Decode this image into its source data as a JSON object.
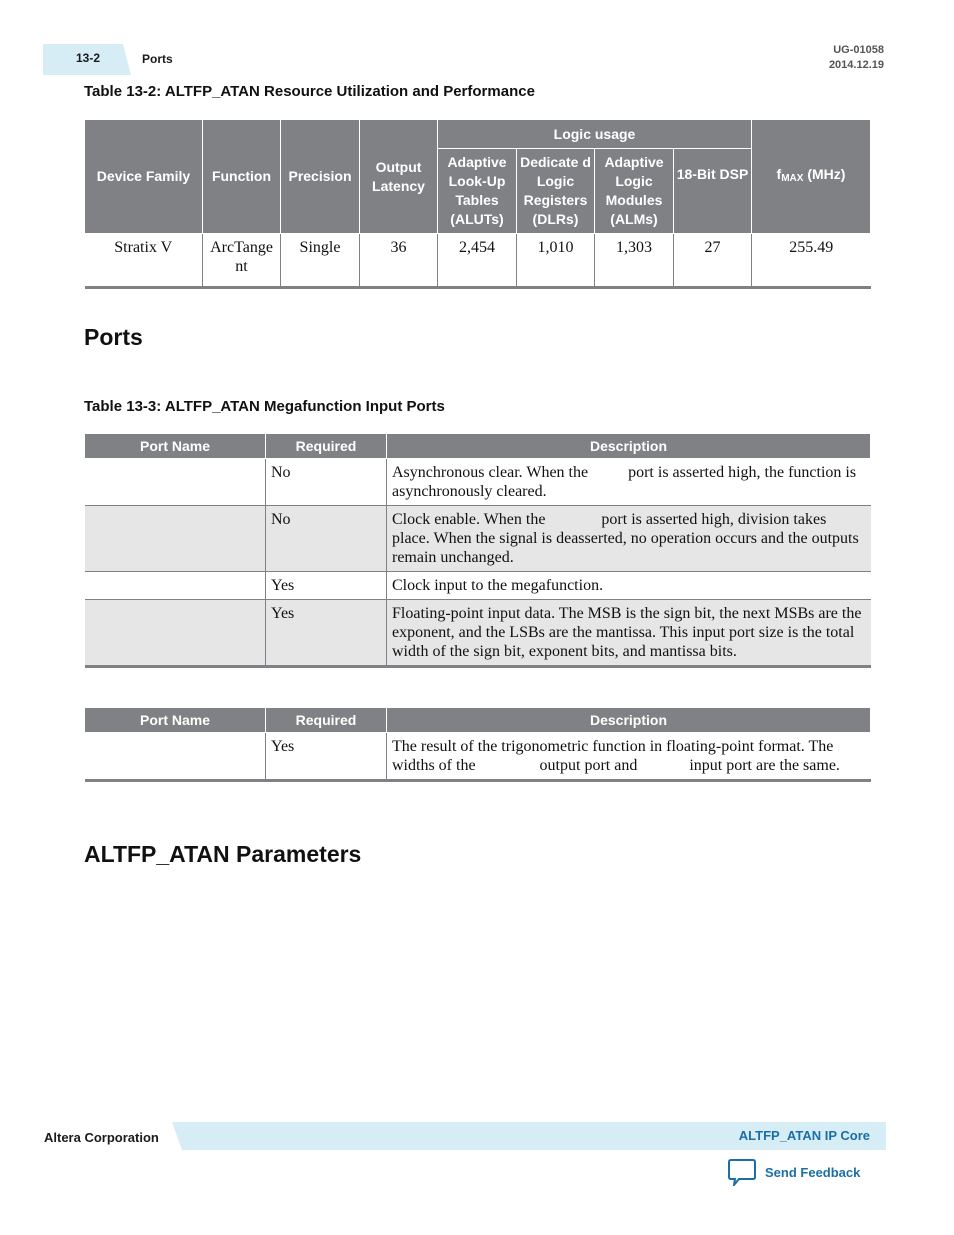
{
  "header": {
    "page_number": "13-2",
    "section": "Ports",
    "doc_id": "UG-01058",
    "date": "2014.12.19"
  },
  "table1": {
    "caption": "Table 13-2: ALTFP_ATAN Resource Utilization and Performance",
    "headers": {
      "device_family": "Device Family",
      "function": "Function",
      "precision": "Precision",
      "output_latency": "Output Latency",
      "logic_usage": "Logic usage",
      "aluts": "Adaptive Look-Up Tables (ALUTs)",
      "dlrs": "Dedicate d Logic Registers (DLRs)",
      "alms": "Adaptive Logic Modules (ALMs)",
      "dsp": "18-Bit DSP",
      "fmax_f": "f",
      "fmax_sub": "MAX",
      "fmax_unit": " (MHz)"
    },
    "rows": [
      {
        "device_family": "Stratix V",
        "function": "ArcTangent",
        "precision": "Single",
        "output_latency": "36",
        "aluts": "2,454",
        "dlrs": "1,010",
        "alms": "1,303",
        "dsp": "27",
        "fmax": "255.49"
      }
    ]
  },
  "ports_heading": "Ports",
  "table2": {
    "caption": "Table 13-3: ALTFP_ATAN Megafunction Input Ports",
    "headers": {
      "port_name": "Port Name",
      "required": "Required",
      "description": "Description"
    },
    "rows": [
      {
        "port_name": "",
        "required": "No",
        "description": "Asynchronous clear. When the          port is asserted high, the function is asynchronously cleared."
      },
      {
        "port_name": "",
        "required": "No",
        "description": "Clock enable. When the              port is asserted high, division takes place. When the signal is deasserted, no operation occurs and the outputs remain unchanged."
      },
      {
        "port_name": "",
        "required": "Yes",
        "description": "Clock input to the megafunction."
      },
      {
        "port_name": "",
        "required": "Yes",
        "description": "Floating-point input data. The MSB is the sign bit, the next MSBs are the exponent, and the LSBs are the mantissa. This input port size is the total width of the sign bit, exponent bits, and mantissa bits."
      }
    ]
  },
  "table3": {
    "headers": {
      "port_name": "Port Name",
      "required": "Required",
      "description": "Description"
    },
    "rows": [
      {
        "port_name": "",
        "required": "Yes",
        "description": "The result of the trigonometric function in floating-point format. The widths of the                output port and             input port are the same."
      }
    ]
  },
  "parameters_heading": "ALTFP_ATAN Parameters",
  "footer": {
    "company": "Altera Corporation",
    "doc_title": "ALTFP_ATAN IP Core",
    "feedback_label": "Send Feedback",
    "accent_color": "#1b6fa8",
    "band_color": "#d6edf5"
  }
}
